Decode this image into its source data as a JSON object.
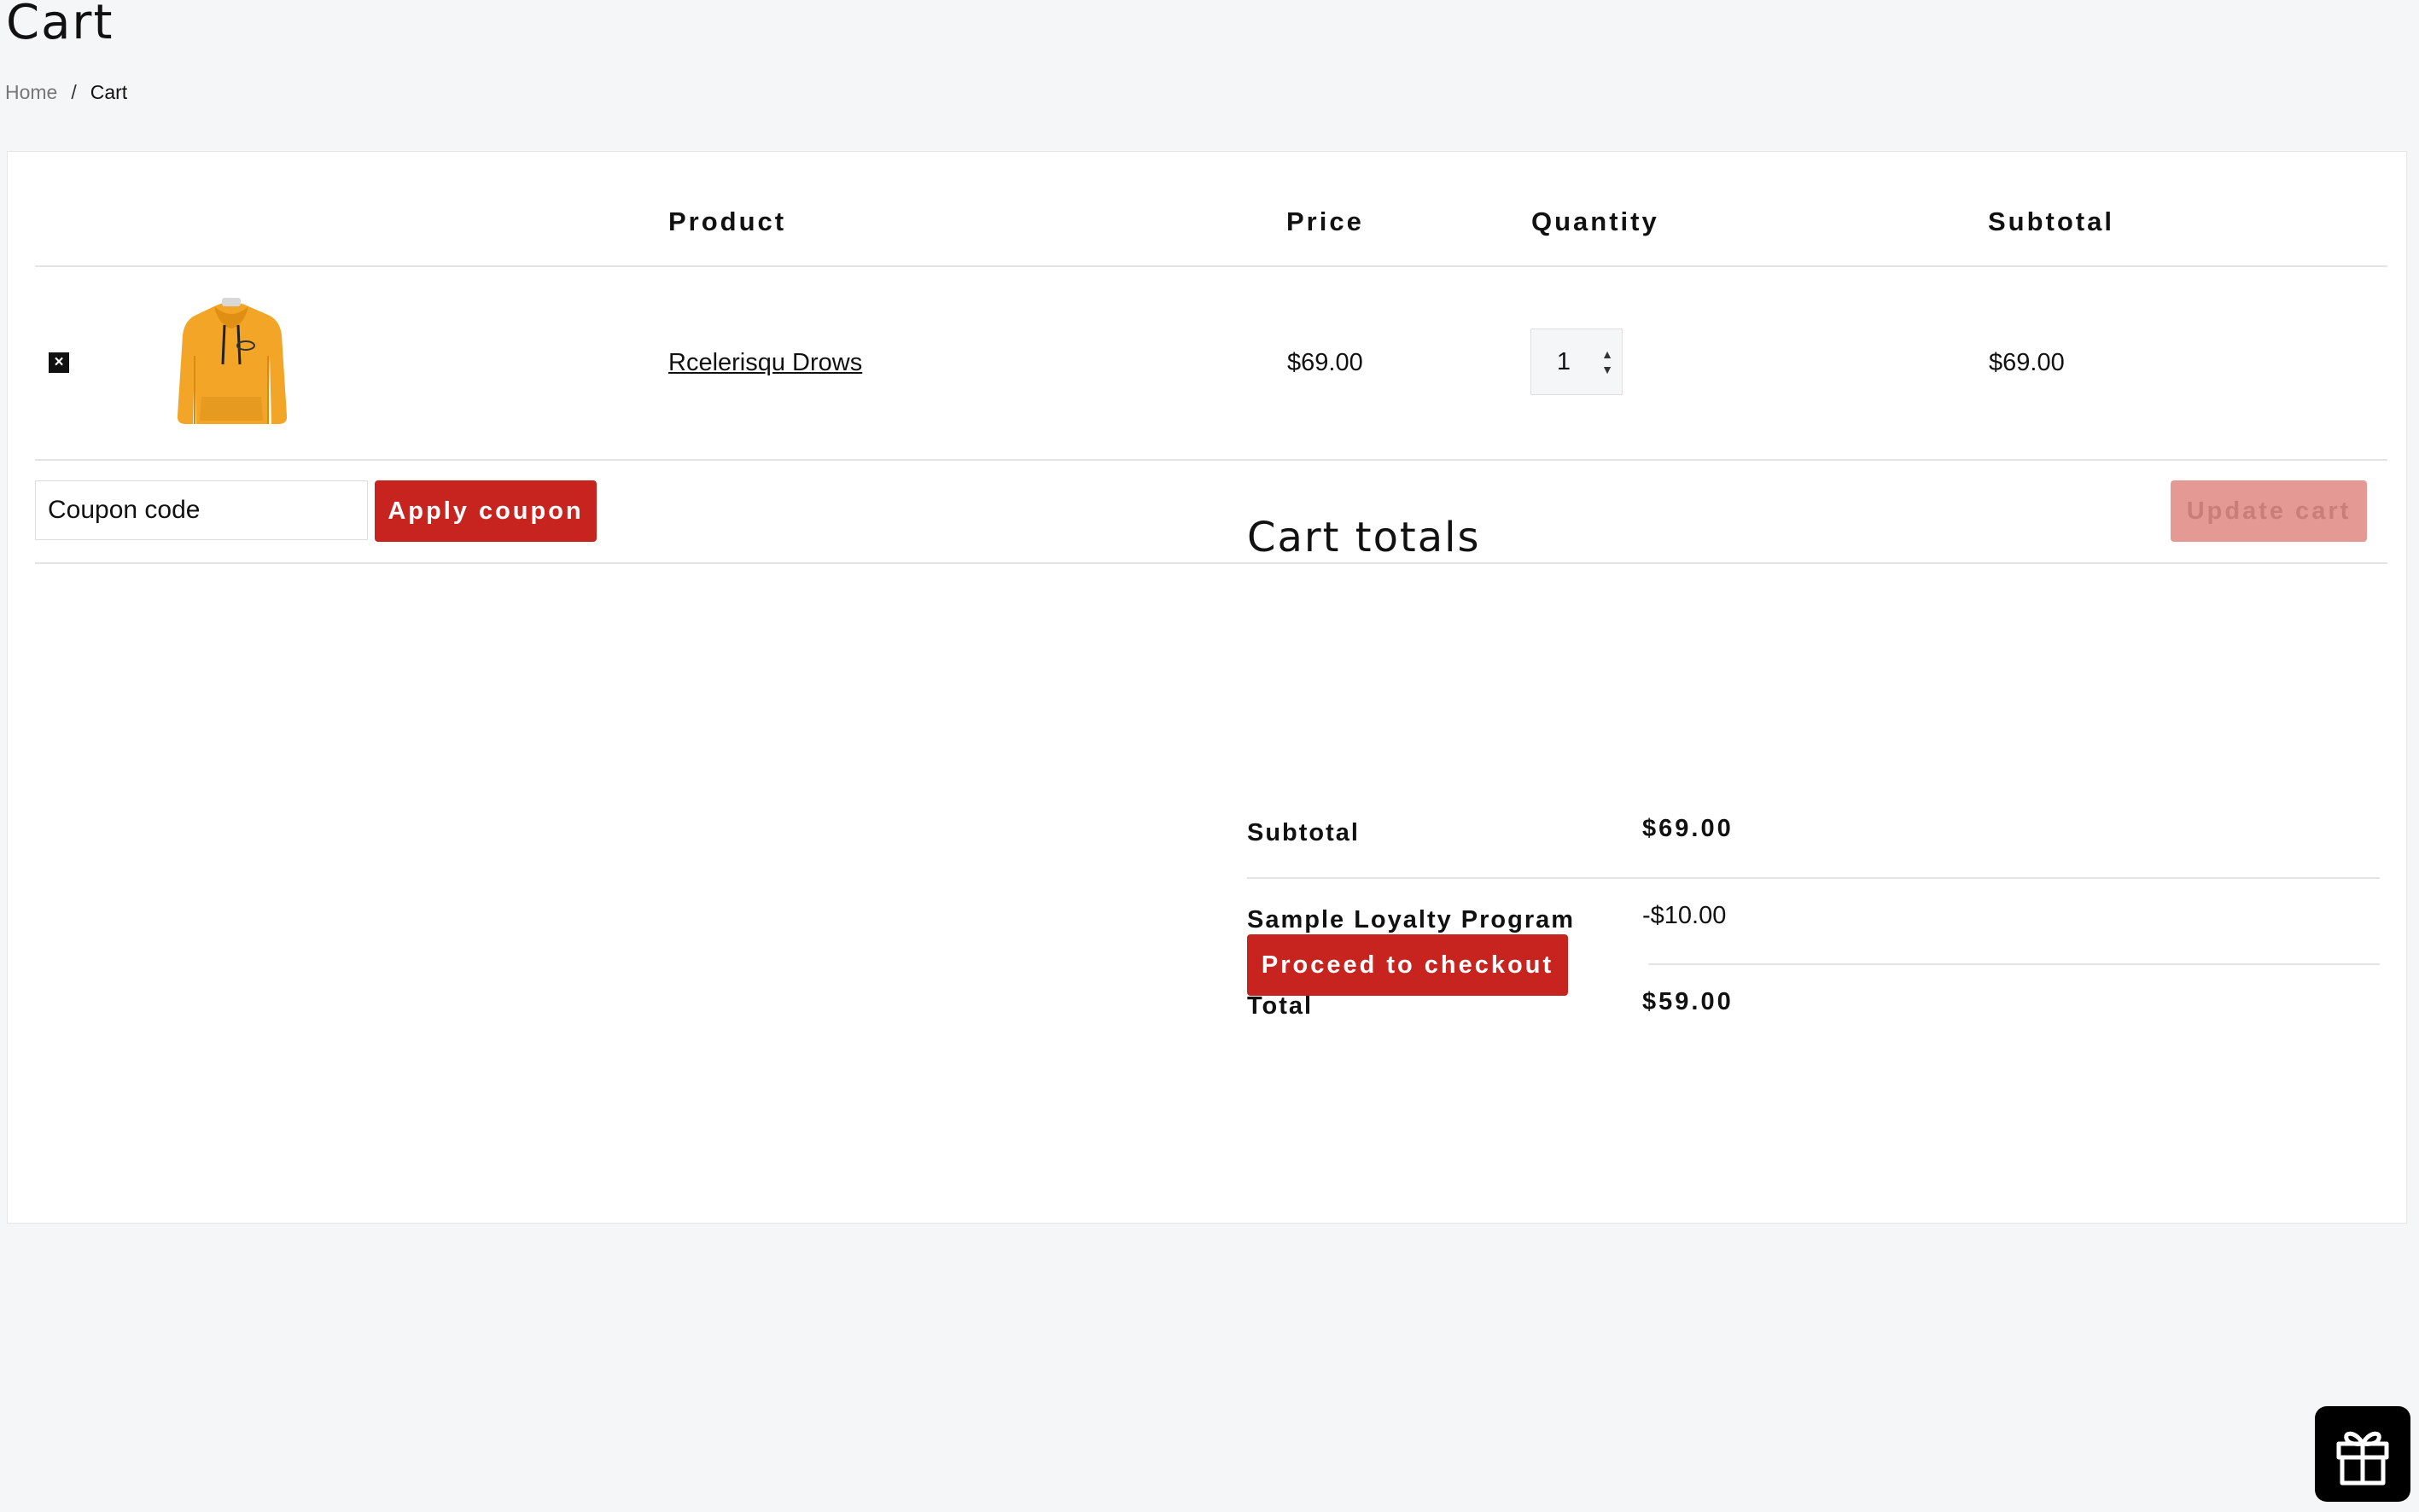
{
  "page": {
    "title": "Cart"
  },
  "breadcrumb": {
    "home": "Home",
    "separator": "/",
    "current": "Cart"
  },
  "table": {
    "headers": {
      "product": "Product",
      "price": "Price",
      "quantity": "Quantity",
      "subtotal": "Subtotal"
    },
    "rows": [
      {
        "remove": "×",
        "product_name": "Rcelerisqu Drows",
        "image_icon": "yellow-hoodie",
        "price": "$69.00",
        "quantity": "1",
        "subtotal": "$69.00"
      }
    ]
  },
  "actions": {
    "coupon_placeholder": "Coupon code",
    "apply_label": "Apply coupon",
    "update_label": "Update cart"
  },
  "totals": {
    "title": "Cart totals",
    "subtotal_label": "Subtotal",
    "subtotal_value": "$69.00",
    "loyalty_label": "Sample Loyalty Program",
    "loyalty_value": "-$10.00",
    "total_label": "Total",
    "total_value": "$59.00",
    "checkout_label": "Proceed to checkout"
  },
  "colors": {
    "accent": "#c8241f",
    "accent_disabled": "#e49995",
    "background": "#f5f6f8"
  },
  "icons": {
    "gift": "gift-icon",
    "remove": "close-icon"
  }
}
